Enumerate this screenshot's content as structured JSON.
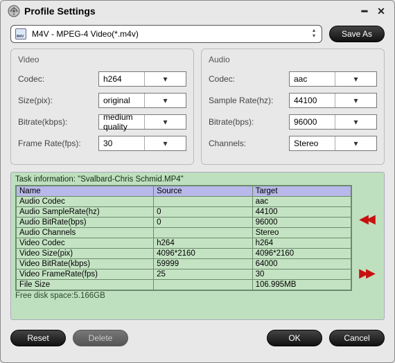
{
  "window": {
    "title": "Profile Settings"
  },
  "profile": {
    "selected": "M4V - MPEG-4 Video(*.m4v)",
    "saveAs": "Save As"
  },
  "videoPanel": {
    "title": "Video",
    "codec_label": "Codec:",
    "codec_value": "h264",
    "size_label": "Size(pix):",
    "size_value": "original",
    "bitrate_label": "Bitrate(kbps):",
    "bitrate_value": "medium quality",
    "framerate_label": "Frame Rate(fps):",
    "framerate_value": "30"
  },
  "audioPanel": {
    "title": "Audio",
    "codec_label": "Codec:",
    "codec_value": "aac",
    "samplerate_label": "Sample Rate(hz):",
    "samplerate_value": "44100",
    "bitrate_label": "Bitrate(bps):",
    "bitrate_value": "96000",
    "channels_label": "Channels:",
    "channels_value": "Stereo"
  },
  "task": {
    "title": "Task information: \"Svalbard-Chris Schmid.MP4\"",
    "headers": {
      "name": "Name",
      "source": "Source",
      "target": "Target"
    },
    "rows": [
      {
        "name": "Audio Codec",
        "source": "",
        "target": "aac"
      },
      {
        "name": "Audio SampleRate(hz)",
        "source": "0",
        "target": "44100"
      },
      {
        "name": "Audio BitRate(bps)",
        "source": "0",
        "target": "96000"
      },
      {
        "name": "Audio Channels",
        "source": "",
        "target": "Stereo"
      },
      {
        "name": "Video Codec",
        "source": "h264",
        "target": "h264"
      },
      {
        "name": "Video Size(pix)",
        "source": "4096*2160",
        "target": "4096*2160"
      },
      {
        "name": "Video BitRate(kbps)",
        "source": "59999",
        "target": "64000"
      },
      {
        "name": "Video FrameRate(fps)",
        "source": "25",
        "target": "30"
      },
      {
        "name": "File Size",
        "source": "",
        "target": "106.995MB"
      }
    ],
    "freeSpace": "Free disk space:5.166GB"
  },
  "buttons": {
    "reset": "Reset",
    "delete": "Delete",
    "ok": "OK",
    "cancel": "Cancel"
  }
}
